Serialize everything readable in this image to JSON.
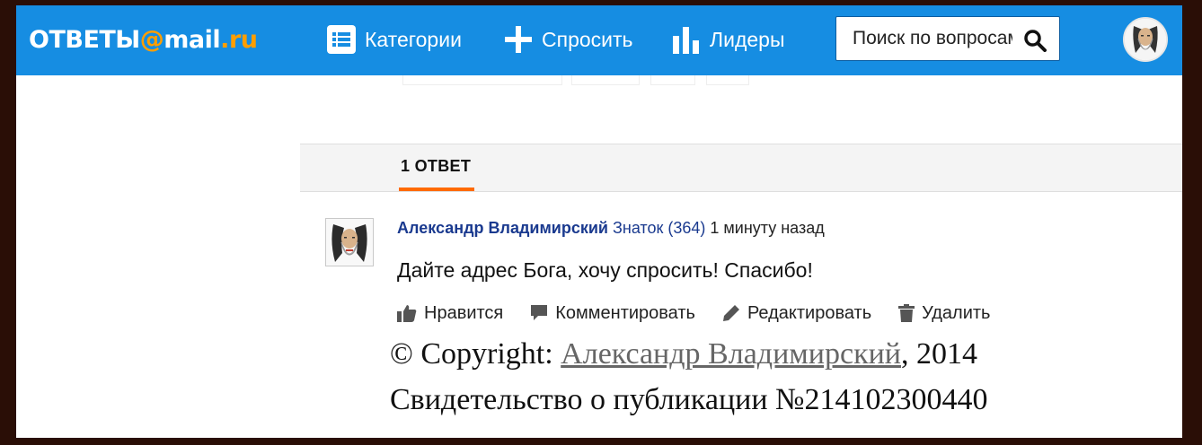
{
  "header": {
    "logo": {
      "part1": "ОТВЕТЫ",
      "at": "@",
      "part2": "mail",
      "dot": ".",
      "part3": "ru"
    },
    "nav": {
      "categories": "Категории",
      "ask": "Спросить",
      "leaders": "Лидеры"
    },
    "search": {
      "value": "Поиск по вопросам"
    }
  },
  "answers": {
    "tab_label": "1 ОТВЕТ",
    "items": [
      {
        "author": "Александр Владимирский",
        "rank": "Знаток (364)",
        "time": "1 минуту назад",
        "text": "Дайте адрес Бога, хочу спросить! Спасибо!",
        "actions": {
          "like": "Нравится",
          "comment": "Комментировать",
          "edit": "Редактировать",
          "delete": "Удалить"
        }
      }
    ]
  },
  "footer": {
    "copyright_prefix": "© Copyright: ",
    "copyright_author": "Александр Владимирский",
    "copyright_year": ", 2014",
    "certificate": "Свидетельство о публикации №214102300440"
  },
  "colors": {
    "header_bg": "#168de2",
    "logo_accent": "#ff9e00",
    "author_link": "#1a3a8f",
    "tab_underline": "#ff6a00"
  }
}
